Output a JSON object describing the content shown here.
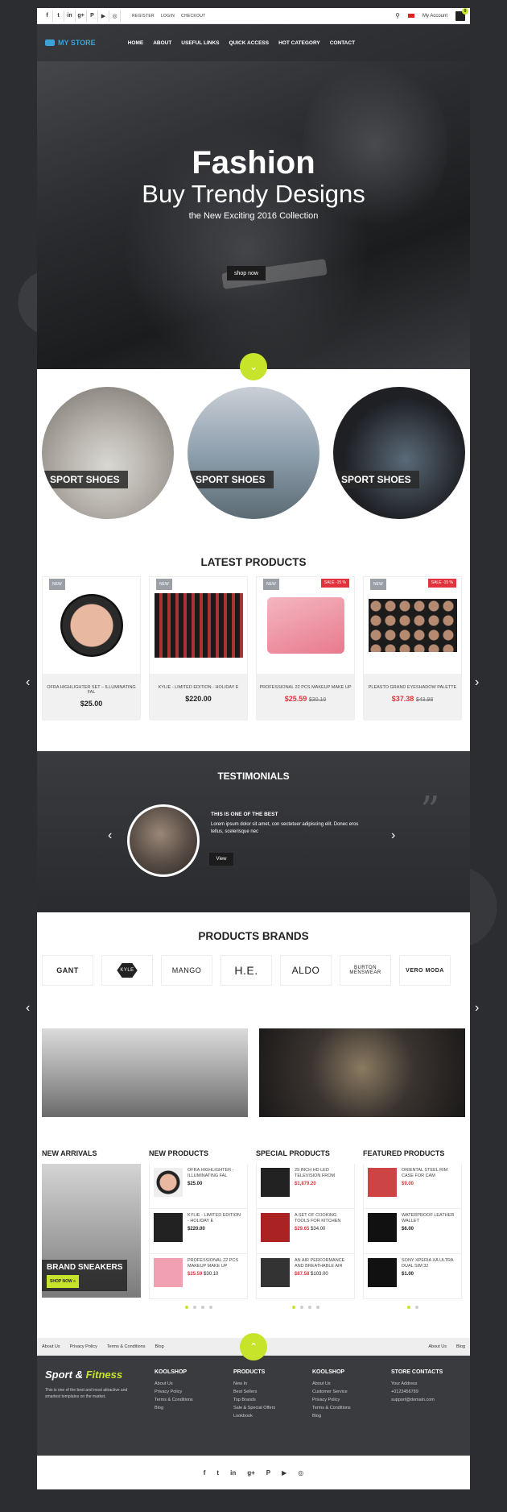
{
  "topbar": {
    "social": [
      "f",
      "t",
      "in",
      "g+",
      "P",
      "▶",
      "◎"
    ],
    "links": [
      "REGISTER",
      "LOGIN",
      "CHECKOUT"
    ],
    "account": "My Account",
    "cart_count": "0"
  },
  "nav": {
    "logo": "MY STORE",
    "menu": [
      "HOME",
      "ABOUT",
      "USEFUL LINKS",
      "QUICK ACCESS",
      "HOT CATEGORY",
      "CONTACT"
    ]
  },
  "hero": {
    "title": "Fashion",
    "subtitle": "Buy Trendy Designs",
    "tagline": "the New Exciting 2016 Collection",
    "button": "shop now"
  },
  "categories": [
    "SPORT SHOES",
    "SPORT SHOES",
    "SPORT SHOES"
  ],
  "latest": {
    "title": "LATEST PRODUCTS",
    "products": [
      {
        "badge": "NEW",
        "sale": "",
        "name": "OFRA HIGHLIGHTER SET – ILLUMINATING FAL",
        "price": "$25.00",
        "old": ""
      },
      {
        "badge": "NEW",
        "sale": "",
        "name": "KYLIE - LIMITED EDITION - HOLIDAY E",
        "price": "$220.00",
        "old": ""
      },
      {
        "badge": "NEW",
        "sale": "SALE -15 %",
        "name": "PROFESSIONAL 22 PCS MAKEUP MAKE UP",
        "price": "$25.59",
        "old": "$30.10"
      },
      {
        "badge": "NEW",
        "sale": "SALE -15 %",
        "name": "PLEASTO GRAND EYESHADOW PALETTE",
        "price": "$37.38",
        "old": "$43.98"
      }
    ]
  },
  "testimonials": {
    "title": "TESTIMONIALS",
    "heading": "THIS IS ONE OF THE BEST",
    "text": "Lorem ipsum dolor sit amet, con sectetuer adipiscing elit. Donec eros tellus, scelerisque nec",
    "button": "View"
  },
  "brands": {
    "title": "PRODUCTS BRANDS",
    "items": [
      "GANT",
      "KYLE",
      "MANGO",
      "H.E.",
      "ALDO",
      "BURTON MENSWEAR",
      "VERO MODA"
    ]
  },
  "lists": {
    "arrivals": {
      "title": "NEW ARRIVALS",
      "banner": "BRAND SNEAKERS",
      "cta": "SHOP NOW »"
    },
    "columns": [
      {
        "title": "NEW PRODUCTS",
        "items": [
          {
            "name": "OFRA HIGHLIGHTER - ILLUMINATING FAL",
            "price": "$25.00",
            "old": ""
          },
          {
            "name": "KYLIE - LIMITED EDITION - HOLIDAY E",
            "price": "$220.00",
            "old": ""
          },
          {
            "name": "PROFESSIONAL 22 PCS MAKEUP MAKE UP",
            "price": "$25.59",
            "old": "$30.10"
          }
        ]
      },
      {
        "title": "SPECIAL PRODUCTS",
        "items": [
          {
            "name": "29 INCH HD LED TELEVISION FROM",
            "price": "$1,879.20",
            "old": ""
          },
          {
            "name": "A SET OF COOKING TOOLS FOR KITCHEN",
            "price": "$29.65",
            "old": "$34.00"
          },
          {
            "name": "AN AIR PERFORMANCE AND BREATHABLE AIR",
            "price": "$87.58",
            "old": "$103.00"
          }
        ]
      },
      {
        "title": "FEATURED PRODUCTS",
        "items": [
          {
            "name": "ORIENTAL STEEL RIM CASE FOR CAM",
            "price": "$9.00",
            "old": ""
          },
          {
            "name": "WATERPROOF LEATHER WALLET",
            "price": "$6.00",
            "old": ""
          },
          {
            "name": "SONY XPERIA XA ULTRA DUAL SIM 32",
            "price": "$1.00",
            "old": ""
          }
        ]
      }
    ]
  },
  "footerbar": {
    "left": [
      "About Us",
      "Privacy Policy",
      "Terms & Conditions",
      "Blog"
    ],
    "right": [
      "About Us",
      "Blog"
    ]
  },
  "footer": {
    "brand1": "Sport",
    "brand2": "Fitness",
    "about": "This is one of the best and most attractive and smartest templates on the market.",
    "cols": [
      {
        "title": "KOOLSHOP",
        "items": [
          "About Us",
          "Privacy Policy",
          "Terms & Conditions",
          "Blog"
        ]
      },
      {
        "title": "PRODUCTS",
        "items": [
          "New In",
          "Best Sellers",
          "Top Brands",
          "Sale & Special Offers",
          "Lookbook"
        ]
      },
      {
        "title": "KOOLSHOP",
        "items": [
          "About Us",
          "Customer Service",
          "Privacy Policy",
          "Terms & Conditions",
          "Blog"
        ]
      },
      {
        "title": "STORE CONTACTS",
        "items": [
          "Your Address",
          "+0123456789",
          "support@domain.com"
        ]
      }
    ]
  },
  "footer_social": [
    "f",
    "t",
    "in",
    "g+",
    "P",
    "▶",
    "◎"
  ],
  "colors": {
    "accent": "#c7e42a",
    "brand": "#3ba3d6",
    "sale": "#e3343d"
  }
}
